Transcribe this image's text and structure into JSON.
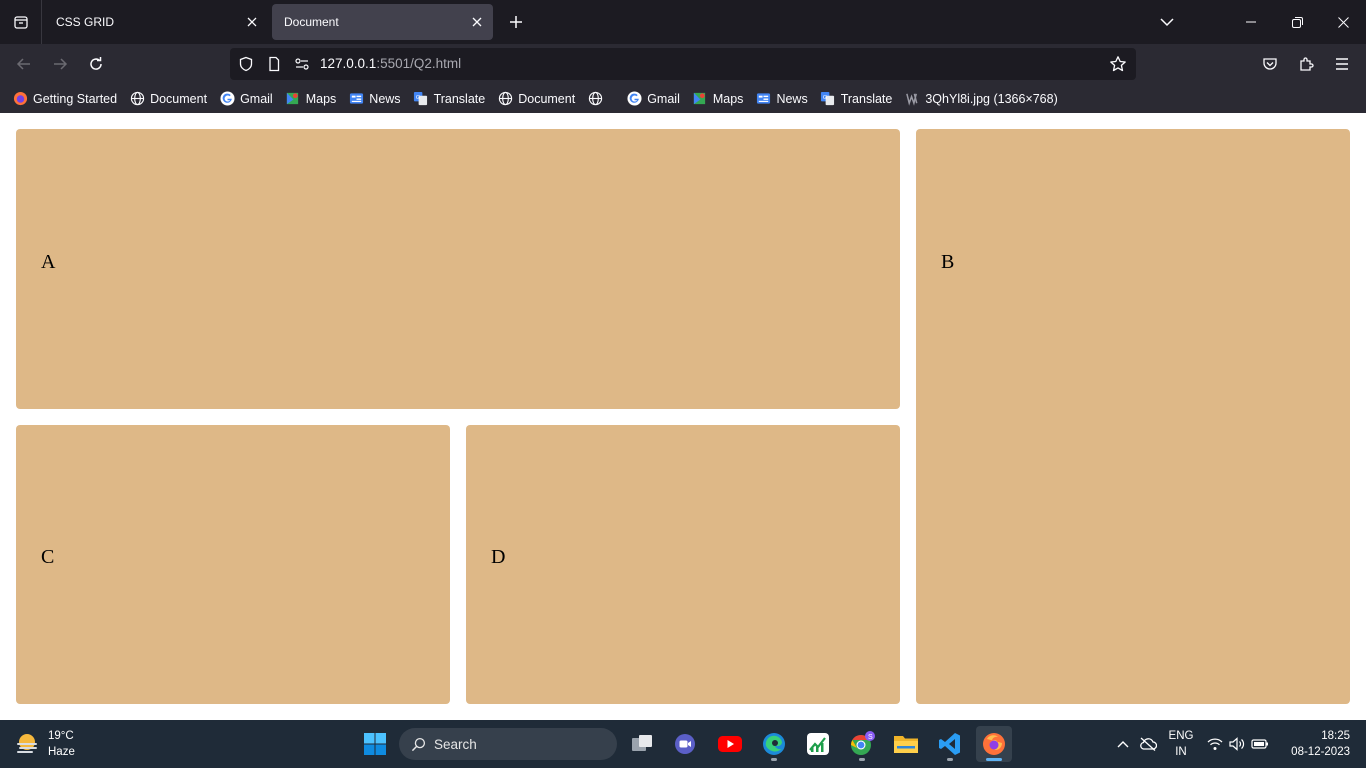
{
  "tabs": [
    {
      "title": "CSS GRID",
      "active": false
    },
    {
      "title": "Document",
      "active": true
    }
  ],
  "navbar": {
    "url_host": "127.0.0.1",
    "url_rest": ":5501/Q2.html"
  },
  "bookmarks": [
    {
      "label": "Getting Started",
      "icon": "firefox-icon"
    },
    {
      "label": "Document",
      "icon": "globe-icon"
    },
    {
      "label": "Gmail",
      "icon": "google-icon"
    },
    {
      "label": "Maps",
      "icon": "maps-icon"
    },
    {
      "label": "News",
      "icon": "news-icon"
    },
    {
      "label": "Translate",
      "icon": "translate-icon"
    },
    {
      "label": "Document",
      "icon": "globe-icon"
    },
    {
      "label": "",
      "icon": "globe-icon"
    },
    {
      "label": "Gmail",
      "icon": "google-icon"
    },
    {
      "label": "Maps",
      "icon": "maps-icon"
    },
    {
      "label": "News",
      "icon": "news-icon"
    },
    {
      "label": "Translate",
      "icon": "translate-icon"
    },
    {
      "label": "3QhYl8i.jpg (1366×768)",
      "icon": "image-file-icon"
    }
  ],
  "content": {
    "boxes": {
      "a": "A",
      "b": "B",
      "c": "C",
      "d": "D"
    },
    "box_color": "#deb887"
  },
  "taskbar": {
    "weather_temp": "19°C",
    "weather_desc": "Haze",
    "search_placeholder": "Search",
    "apps": [
      "task-view",
      "teams-meet",
      "youtube",
      "edge",
      "stock-app",
      "chrome",
      "file-explorer",
      "vscode",
      "firefox"
    ],
    "lang_top": "ENG",
    "lang_bottom": "IN",
    "time": "18:25",
    "date": "08-12-2023"
  }
}
